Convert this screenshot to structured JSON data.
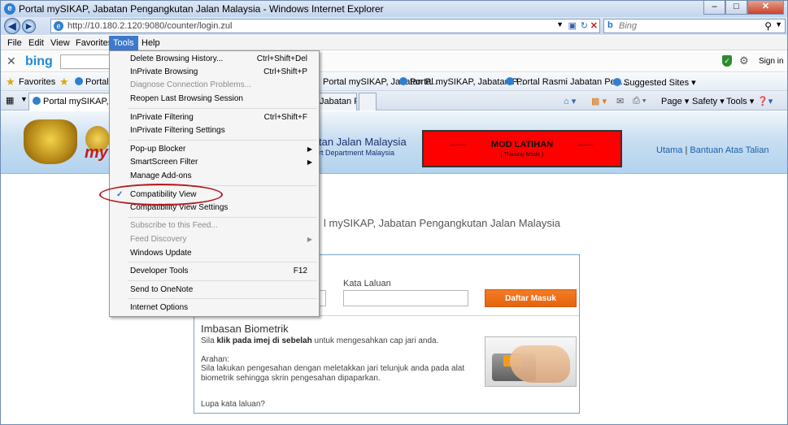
{
  "window": {
    "title": "Portal mySIKAP, Jabatan Pengangkutan Jalan Malaysia - Windows Internet Explorer",
    "min": "–",
    "max": "□",
    "close": "✕"
  },
  "address": {
    "url": "http://10.180.2.120:9080/counter/login.zul",
    "search_placeholder": "Bing"
  },
  "menu": {
    "file": "File",
    "edit": "Edit",
    "view": "View",
    "favorites": "Favorites",
    "tools": "Tools",
    "help": "Help"
  },
  "bingbar": {
    "logo": "bing",
    "signin": "Sign in"
  },
  "favbar": {
    "label": "Favorites",
    "items": [
      "Portal",
      "Portal mySIKAP, Jabatan P...",
      "Portal mySIKAP, Jabatan P...",
      "Portal Rasmi Jabatan Pen...",
      "Suggested Sites ▾"
    ]
  },
  "tabs": {
    "tab1": "Portal mySIKAP, Jab",
    "tab2": "Jabatan P..."
  },
  "commandbar": {
    "page": "Page ▾",
    "safety": "Safety ▾",
    "tools": "Tools ▾"
  },
  "tools_menu": {
    "items": [
      {
        "label": "Delete Browsing History...",
        "shortcut": "Ctrl+Shift+Del"
      },
      {
        "label": "InPrivate Browsing",
        "shortcut": "Ctrl+Shift+P"
      },
      {
        "label": "Diagnose Connection Problems...",
        "shortcut": ""
      },
      {
        "label": "Reopen Last Browsing Session",
        "shortcut": ""
      },
      {
        "label": "InPrivate Filtering",
        "shortcut": "Ctrl+Shift+F"
      },
      {
        "label": "InPrivate Filtering Settings",
        "shortcut": ""
      },
      {
        "label": "Pop-up Blocker",
        "shortcut": ""
      },
      {
        "label": "SmartScreen Filter",
        "shortcut": ""
      },
      {
        "label": "Manage Add-ons",
        "shortcut": ""
      },
      {
        "label": "Compatibility View",
        "shortcut": ""
      },
      {
        "label": "Compatibility View Settings",
        "shortcut": ""
      },
      {
        "label": "Subscribe to this Feed...",
        "shortcut": ""
      },
      {
        "label": "Feed Discovery",
        "shortcut": ""
      },
      {
        "label": "Windows Update",
        "shortcut": ""
      },
      {
        "label": "Developer Tools",
        "shortcut": "F12"
      },
      {
        "label": "Send to OneNote",
        "shortcut": ""
      },
      {
        "label": "Internet Options",
        "shortcut": ""
      }
    ]
  },
  "banner": {
    "logo_text": "my",
    "title": "tan Jalan Malaysia",
    "subtitle": "rt Department Malaysia",
    "mode_title": "MOD LATIHAN",
    "mode_sub": "( Training Mode )",
    "mode_dashes": "--------",
    "link_utama": "Utama",
    "link_sep": "|",
    "link_bantuan": "Bantuan Atas Talian"
  },
  "page": {
    "welcome": "l mySIKAP, Jabatan Pengangkutan Jalan Malaysia",
    "password_label": "Kata Laluan",
    "login_button": "Daftar Masuk",
    "bio_heading": "Imbasan Biometrik",
    "bio_text_pre": "Sila ",
    "bio_text_bold": "klik pada imej di sebelah",
    "bio_text_post": " untuk mengesahkan cap jari anda.",
    "arahan_label": "Arahan:",
    "arahan_text": "Sila lakukan pengesahan dengan meletakkan jari telunjuk anda pada alat biometrik sehingga skrin pengesahan dipaparkan.",
    "forgot": "Lupa kata laluan?"
  }
}
